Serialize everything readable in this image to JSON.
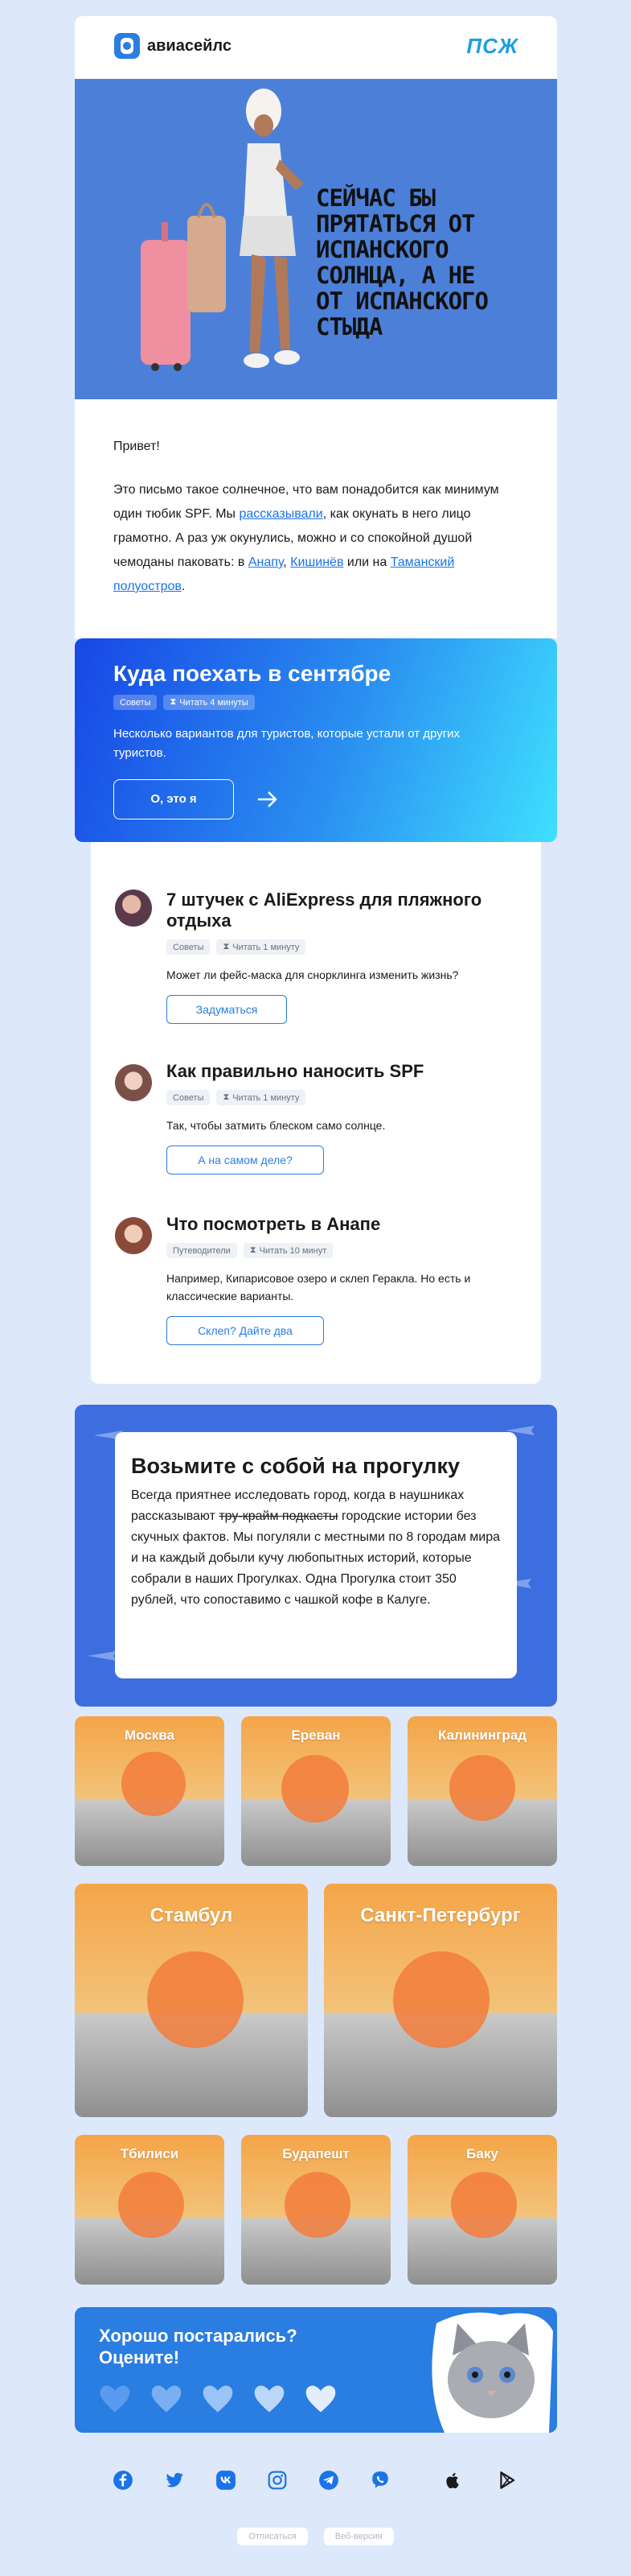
{
  "header": {
    "brand": "авиасейлс",
    "partner_logo": "ПСЖ"
  },
  "hero": {
    "headline": "СЕЙЧАС БЫ ПРЯТАТЬСЯ ОТ ИСПАНСКОГО СОЛНЦА, А НЕ ОТ ИСПАНСКОГО СТЫДА"
  },
  "intro": {
    "greeting": "Привет!",
    "p1": "Это письмо такое солнечное, что вам понадобится как минимум один тюбик SPF. Мы ",
    "link_told": "рассказывали",
    "p2": ", как окунать в него лицо грамотно. А раз уж окунулись, можно и со спокойной душой чемоданы паковать: в ",
    "link_anapa": "Анапу",
    "sep1": ", ",
    "link_kishinev": "Кишинёв",
    "sep2": " или на ",
    "link_taman": "Таманский полуостров",
    "end": "."
  },
  "feature": {
    "title": "Куда поехать в сентябре",
    "tag": "Советы",
    "read_time": "Читать 4 минуты",
    "desc": "Несколько вариантов для туристов, которые устали от других туристов.",
    "button": "О, это я"
  },
  "articles": [
    {
      "title": "7 штучек с AliExpress для пляжного отдыха",
      "tag": "Советы",
      "read_time": "Читать 1 минуту",
      "desc": "Может ли фейс-маска для снорклинга изменить жизнь?",
      "button": "Задуматься"
    },
    {
      "title": "Как правильно наносить SPF",
      "tag": "Советы",
      "read_time": "Читать 1 минуту",
      "desc": "Так, чтобы затмить блеском само солнце.",
      "button": "А на самом деле?"
    },
    {
      "title": "Что посмотреть в Анапе",
      "tag": "Путеводители",
      "read_time": "Читать 10 минут",
      "desc": "Например, Кипарисовое озеро и склеп Геракла. Но есть и классические варианты.",
      "button": "Склеп? Дайте два"
    }
  ],
  "walks": {
    "title": "Возьмите с собой на прогулку",
    "t1": "Всегда приятнее исследовать город, когда в наушниках рассказывают ",
    "strike": "тру-крайм подкасты",
    "t2": " городские истории без скучных фактов. Мы погуляли с местными по 8 городам мира и на каждый добыли кучу любопытных историй, которые собрали в наших Прогулках. Одна Прогулка стоит 350 рублей, что сопоставимо с чашкой кофе в Калуге."
  },
  "cities": [
    "Москва",
    "Ереван",
    "Калининград",
    "Стамбул",
    "Санкт-Петербург",
    "Тбилиси",
    "Будапешт",
    "Баку"
  ],
  "rating": {
    "title": "Хорошо постарались? Оцените!"
  },
  "social": [
    "facebook-icon",
    "twitter-icon",
    "vk-icon",
    "instagram-icon",
    "telegram-icon",
    "viber-icon",
    "apple-icon",
    "google-play-icon"
  ],
  "footer": {
    "unsubscribe": "Отписаться",
    "web_version": "Веб-версия"
  },
  "colors": {
    "brand_blue": "#2a7de1",
    "hero_bg": "#4c80d8",
    "walks_bg": "#3c6ee0",
    "city_orange": "#f5a548"
  }
}
